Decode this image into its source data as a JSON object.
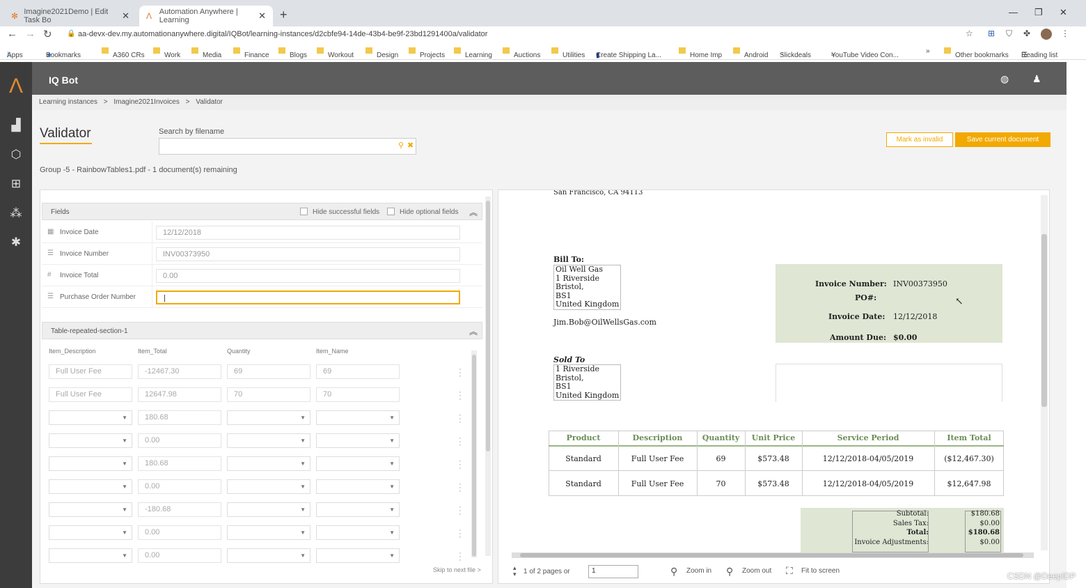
{
  "browser": {
    "tabs": [
      {
        "title": "Imagine2021Demo | Edit Task Bo",
        "active": false
      },
      {
        "title": "Automation Anywhere | Learning",
        "active": true
      }
    ],
    "url": "aa-devx-dev.my.automationanywhere.digital/IQBot/learning-instances/d2cbfe94-14de-43b4-be9f-23bd1291400a/validator",
    "bookmarks": [
      "Apps",
      "Bookmarks",
      "A360 CRs",
      "Work",
      "Media",
      "Finance",
      "Blogs",
      "Workout",
      "Design",
      "Projects",
      "Learning",
      "Auctions",
      "Utilities",
      "Create Shipping La...",
      "Home Imp",
      "Android",
      "Slickdeals",
      "YouTube Video Con..."
    ],
    "bookmarks_more": "»",
    "other_bookmarks": "Other bookmarks",
    "reading_list": "Reading list"
  },
  "app": {
    "title": "IQ Bot",
    "breadcrumb": [
      "Learning instances",
      ">",
      "Imagine2021Invoices",
      ">",
      "Validator"
    ],
    "page_title": "Validator",
    "search_label": "Search by filename",
    "search_value": "",
    "mark_invalid": "Mark as invalid",
    "save_current": "Save current document",
    "group_info": "Group -5 - RainbowTables1.pdf - 1 document(s) remaining",
    "accent": "#f2a900"
  },
  "fields_panel": {
    "title": "Fields",
    "hide_successful": "Hide successful fields",
    "hide_optional": "Hide optional fields",
    "fields": [
      {
        "icon": "calendar-icon",
        "label": "Invoice Date",
        "value": "12/12/2018"
      },
      {
        "icon": "text-lines-icon",
        "label": "Invoice Number",
        "value": "INV00373950"
      },
      {
        "icon": "hash-icon",
        "label": "Invoice Total",
        "value": "0.00"
      },
      {
        "icon": "text-lines-icon",
        "label": "Purchase Order Number",
        "value": "|"
      }
    ]
  },
  "table_panel": {
    "title": "Table-repeated-section-1",
    "columns": [
      "Item_Description",
      "Item_Total",
      "Quantity",
      "Item_Name"
    ],
    "rows": [
      {
        "desc": "Full User Fee",
        "total": "-12467.30",
        "qty": "69",
        "name": "69",
        "dropdown": false
      },
      {
        "desc": "Full User Fee",
        "total": "12647.98",
        "qty": "70",
        "name": "70",
        "dropdown": false
      },
      {
        "desc": "",
        "total": "180.68",
        "qty": "",
        "name": "",
        "dropdown": true
      },
      {
        "desc": "",
        "total": "0.00",
        "qty": "",
        "name": "",
        "dropdown": true
      },
      {
        "desc": "",
        "total": "180.68",
        "qty": "",
        "name": "",
        "dropdown": true
      },
      {
        "desc": "",
        "total": "0.00",
        "qty": "",
        "name": "",
        "dropdown": true
      },
      {
        "desc": "",
        "total": "-180.68",
        "qty": "",
        "name": "",
        "dropdown": true
      },
      {
        "desc": "",
        "total": "0.00",
        "qty": "",
        "name": "",
        "dropdown": true
      },
      {
        "desc": "",
        "total": "0.00",
        "qty": "",
        "name": "",
        "dropdown": true
      }
    ],
    "skip_next": "Skip to next file >"
  },
  "document": {
    "address_top": "San Francisco, CA 94113",
    "bill_to_label": "Bill To:",
    "bill_to": [
      "Oil Well Gas",
      "1 Riverside",
      "Bristol,",
      "BS1",
      "United Kingdom"
    ],
    "email": "Jim.Bob@OilWellsGas.com",
    "sold_to_label": "Sold To",
    "sold_to": [
      "1 Riverside",
      "Bristol,",
      "BS1",
      "United Kingdom"
    ],
    "summary": [
      {
        "label": "Invoice Number:",
        "value": "INV00373950"
      },
      {
        "label": "PO#:",
        "value": ""
      },
      {
        "label": "Invoice Date:",
        "value": "12/12/2018"
      },
      {
        "label": "Amount Due:",
        "value": "$0.00"
      }
    ],
    "table_headers": [
      "Product",
      "Description",
      "Quantity",
      "Unit Price",
      "Service Period",
      "Item Total"
    ],
    "table_rows": [
      [
        "Standard",
        "Full User Fee",
        "69",
        "$573.48",
        "12/12/2018-04/05/2019",
        "($12,467.30)"
      ],
      [
        "Standard",
        "Full User Fee",
        "70",
        "$573.48",
        "12/12/2018-04/05/2019",
        "$12,647.98"
      ]
    ],
    "totals": [
      {
        "label": "Subtotal:",
        "value": "$180.68",
        "bold": false
      },
      {
        "label": "Sales Tax:",
        "value": "$0.00",
        "bold": false
      },
      {
        "label": "Total:",
        "value": "$180.68",
        "bold": true
      },
      {
        "label": "Invoice Adjustments:",
        "value": "$0.00",
        "bold": false
      }
    ]
  },
  "viewer_footer": {
    "pages": "1 of 2 pages or",
    "page_input": "1",
    "zoom_in": "Zoom in",
    "zoom_out": "Zoom out",
    "fit": "Fit to screen"
  },
  "watermark": "CSDN @DeepIDP"
}
